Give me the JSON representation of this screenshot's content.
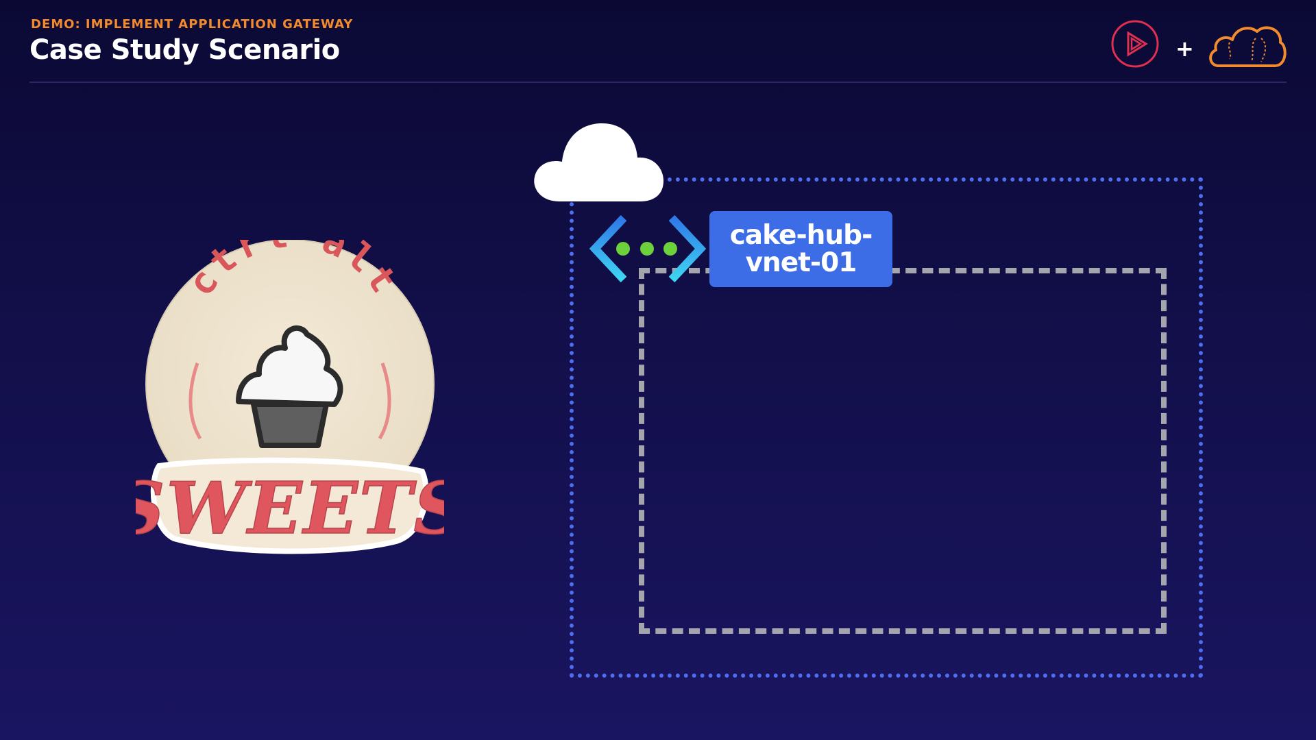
{
  "header": {
    "eyebrow": "DEMO: IMPLEMENT APPLICATION GATEWAY",
    "title": "Case Study Scenario",
    "plus": "+"
  },
  "brand_icons": [
    "pluralsight-play-icon",
    "cloud-brain-icon"
  ],
  "diagram": {
    "vnet_label": "cake-hub-vnet-01",
    "icons": [
      "cloud-icon",
      "virtual-network-icon"
    ]
  },
  "logo": {
    "top_text": "ctrl alt",
    "bottom_text": "SWEETS",
    "icon": "cupcake-icon"
  },
  "colors": {
    "eyebrow": "#f28a2e",
    "outer_boundary": "#4d6ef0",
    "inner_boundary": "#a5a5ad",
    "label_bg": "#3d6de6",
    "brand_red": "#e0304f",
    "brand_orange": "#f28a2e"
  }
}
